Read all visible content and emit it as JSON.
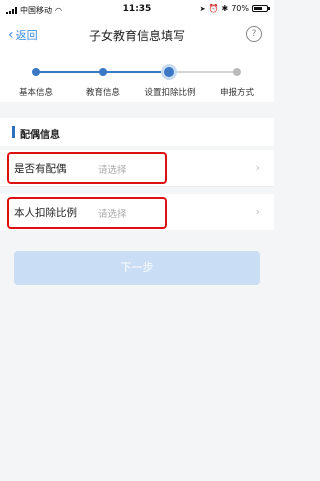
{
  "status_bar": {
    "carrier": "中国移动",
    "time": "11:35",
    "battery_percent": "70%",
    "battery_level": 0.7
  },
  "nav": {
    "back_label": "返回",
    "title": "子女教育信息填写",
    "help_icon": "?"
  },
  "steps": [
    {
      "label": "基本信息",
      "state": "done"
    },
    {
      "label": "教育信息",
      "state": "done"
    },
    {
      "label": "设置扣除比例",
      "state": "current"
    },
    {
      "label": "申报方式",
      "state": "todo"
    }
  ],
  "section": {
    "title": "配偶信息"
  },
  "fields": [
    {
      "label": "是否有配偶",
      "placeholder": "请选择"
    },
    {
      "label": "本人扣除比例",
      "placeholder": "请选择"
    }
  ],
  "next_button": {
    "label": "下一步",
    "enabled": false
  },
  "colors": {
    "accent": "#3a78c4",
    "highlight": "#dd1111",
    "button_disabled": "#c9ddf4"
  }
}
